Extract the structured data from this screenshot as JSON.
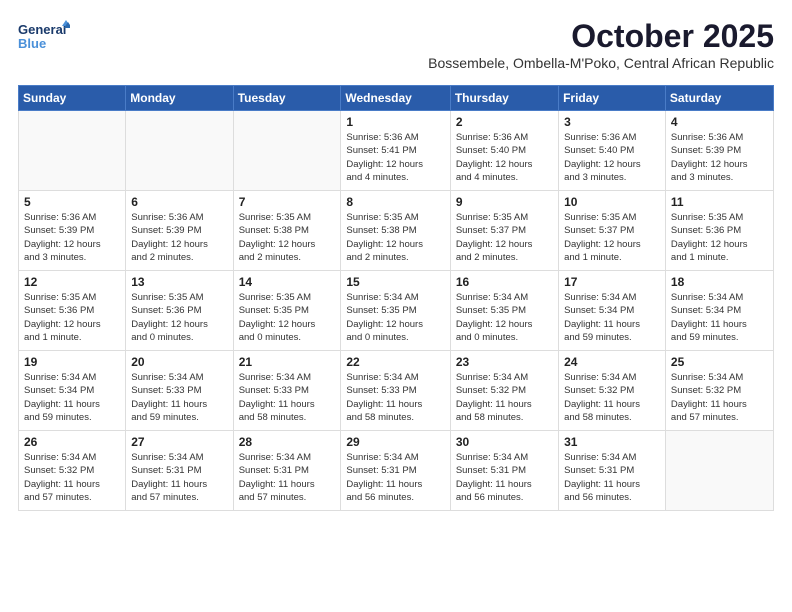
{
  "logo": {
    "line1": "General",
    "line2": "Blue"
  },
  "title": "October 2025",
  "subtitle": "Bossembele, Ombella-M'Poko, Central African Republic",
  "weekdays": [
    "Sunday",
    "Monday",
    "Tuesday",
    "Wednesday",
    "Thursday",
    "Friday",
    "Saturday"
  ],
  "weeks": [
    [
      {
        "day": "",
        "info": ""
      },
      {
        "day": "",
        "info": ""
      },
      {
        "day": "",
        "info": ""
      },
      {
        "day": "1",
        "info": "Sunrise: 5:36 AM\nSunset: 5:41 PM\nDaylight: 12 hours\nand 4 minutes."
      },
      {
        "day": "2",
        "info": "Sunrise: 5:36 AM\nSunset: 5:40 PM\nDaylight: 12 hours\nand 4 minutes."
      },
      {
        "day": "3",
        "info": "Sunrise: 5:36 AM\nSunset: 5:40 PM\nDaylight: 12 hours\nand 3 minutes."
      },
      {
        "day": "4",
        "info": "Sunrise: 5:36 AM\nSunset: 5:39 PM\nDaylight: 12 hours\nand 3 minutes."
      }
    ],
    [
      {
        "day": "5",
        "info": "Sunrise: 5:36 AM\nSunset: 5:39 PM\nDaylight: 12 hours\nand 3 minutes."
      },
      {
        "day": "6",
        "info": "Sunrise: 5:36 AM\nSunset: 5:39 PM\nDaylight: 12 hours\nand 2 minutes."
      },
      {
        "day": "7",
        "info": "Sunrise: 5:35 AM\nSunset: 5:38 PM\nDaylight: 12 hours\nand 2 minutes."
      },
      {
        "day": "8",
        "info": "Sunrise: 5:35 AM\nSunset: 5:38 PM\nDaylight: 12 hours\nand 2 minutes."
      },
      {
        "day": "9",
        "info": "Sunrise: 5:35 AM\nSunset: 5:37 PM\nDaylight: 12 hours\nand 2 minutes."
      },
      {
        "day": "10",
        "info": "Sunrise: 5:35 AM\nSunset: 5:37 PM\nDaylight: 12 hours\nand 1 minute."
      },
      {
        "day": "11",
        "info": "Sunrise: 5:35 AM\nSunset: 5:36 PM\nDaylight: 12 hours\nand 1 minute."
      }
    ],
    [
      {
        "day": "12",
        "info": "Sunrise: 5:35 AM\nSunset: 5:36 PM\nDaylight: 12 hours\nand 1 minute."
      },
      {
        "day": "13",
        "info": "Sunrise: 5:35 AM\nSunset: 5:36 PM\nDaylight: 12 hours\nand 0 minutes."
      },
      {
        "day": "14",
        "info": "Sunrise: 5:35 AM\nSunset: 5:35 PM\nDaylight: 12 hours\nand 0 minutes."
      },
      {
        "day": "15",
        "info": "Sunrise: 5:34 AM\nSunset: 5:35 PM\nDaylight: 12 hours\nand 0 minutes."
      },
      {
        "day": "16",
        "info": "Sunrise: 5:34 AM\nSunset: 5:35 PM\nDaylight: 12 hours\nand 0 minutes."
      },
      {
        "day": "17",
        "info": "Sunrise: 5:34 AM\nSunset: 5:34 PM\nDaylight: 11 hours\nand 59 minutes."
      },
      {
        "day": "18",
        "info": "Sunrise: 5:34 AM\nSunset: 5:34 PM\nDaylight: 11 hours\nand 59 minutes."
      }
    ],
    [
      {
        "day": "19",
        "info": "Sunrise: 5:34 AM\nSunset: 5:34 PM\nDaylight: 11 hours\nand 59 minutes."
      },
      {
        "day": "20",
        "info": "Sunrise: 5:34 AM\nSunset: 5:33 PM\nDaylight: 11 hours\nand 59 minutes."
      },
      {
        "day": "21",
        "info": "Sunrise: 5:34 AM\nSunset: 5:33 PM\nDaylight: 11 hours\nand 58 minutes."
      },
      {
        "day": "22",
        "info": "Sunrise: 5:34 AM\nSunset: 5:33 PM\nDaylight: 11 hours\nand 58 minutes."
      },
      {
        "day": "23",
        "info": "Sunrise: 5:34 AM\nSunset: 5:32 PM\nDaylight: 11 hours\nand 58 minutes."
      },
      {
        "day": "24",
        "info": "Sunrise: 5:34 AM\nSunset: 5:32 PM\nDaylight: 11 hours\nand 58 minutes."
      },
      {
        "day": "25",
        "info": "Sunrise: 5:34 AM\nSunset: 5:32 PM\nDaylight: 11 hours\nand 57 minutes."
      }
    ],
    [
      {
        "day": "26",
        "info": "Sunrise: 5:34 AM\nSunset: 5:32 PM\nDaylight: 11 hours\nand 57 minutes."
      },
      {
        "day": "27",
        "info": "Sunrise: 5:34 AM\nSunset: 5:31 PM\nDaylight: 11 hours\nand 57 minutes."
      },
      {
        "day": "28",
        "info": "Sunrise: 5:34 AM\nSunset: 5:31 PM\nDaylight: 11 hours\nand 57 minutes."
      },
      {
        "day": "29",
        "info": "Sunrise: 5:34 AM\nSunset: 5:31 PM\nDaylight: 11 hours\nand 56 minutes."
      },
      {
        "day": "30",
        "info": "Sunrise: 5:34 AM\nSunset: 5:31 PM\nDaylight: 11 hours\nand 56 minutes."
      },
      {
        "day": "31",
        "info": "Sunrise: 5:34 AM\nSunset: 5:31 PM\nDaylight: 11 hours\nand 56 minutes."
      },
      {
        "day": "",
        "info": ""
      }
    ]
  ]
}
